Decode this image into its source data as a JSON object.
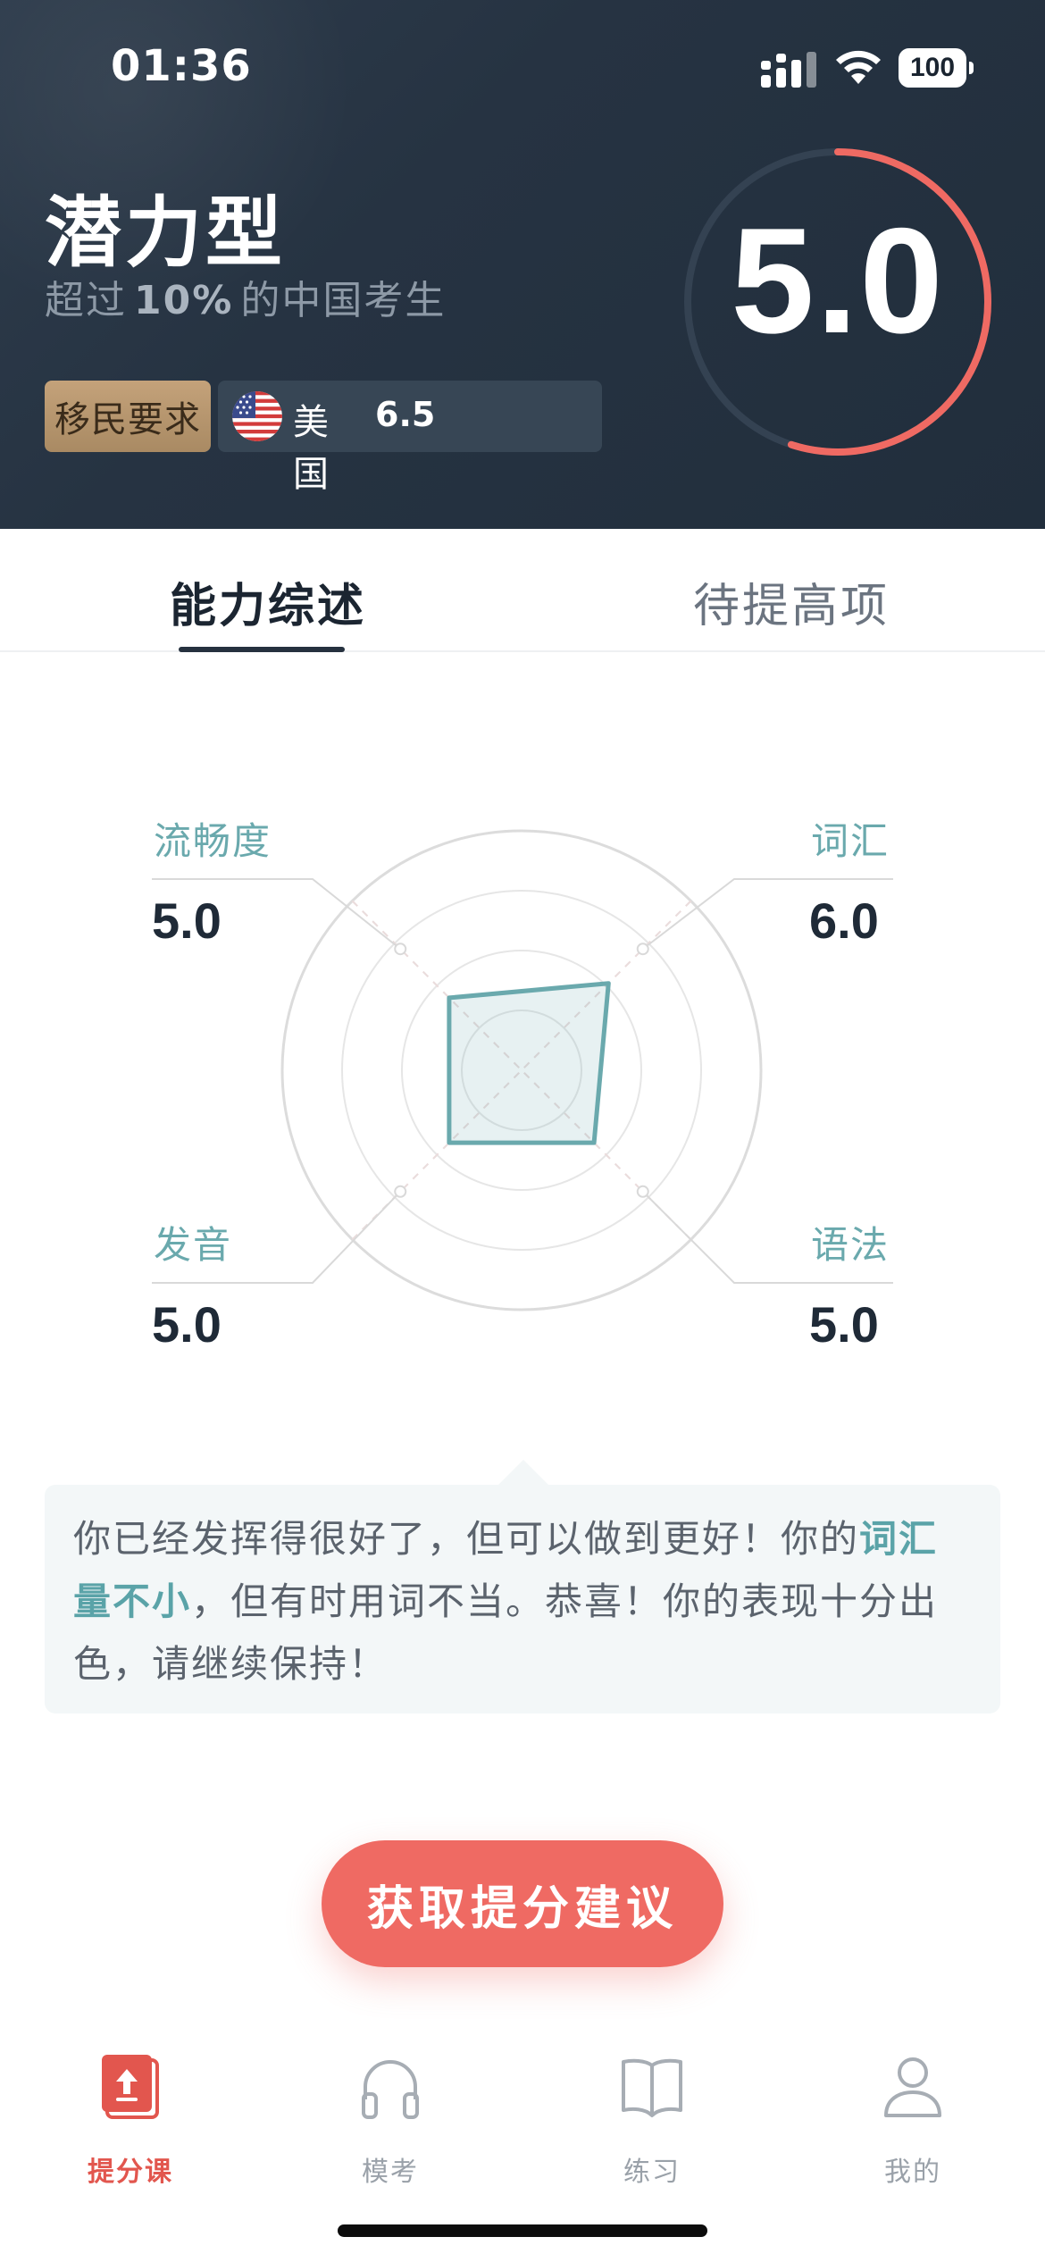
{
  "status_bar": {
    "time": "01:36",
    "battery": "100"
  },
  "header": {
    "level_title": "潜力型",
    "subtitle_prefix": "超过",
    "subtitle_percent": "10%",
    "subtitle_suffix": "的中国考生",
    "requirement_tag": "移民要求",
    "requirement_country": "美国",
    "requirement_score": "6.5",
    "overall_score": "5.0",
    "overall_score_fraction": 0.55,
    "colors": {
      "ring_accent": "#ef6a63",
      "ring_track": "#344252",
      "tag_gold": "#c4a27a"
    }
  },
  "tabs": [
    {
      "label": "能力综述",
      "active": true
    },
    {
      "label": "待提高项",
      "active": false
    }
  ],
  "skills": {
    "fluency": {
      "label": "流畅度",
      "score": "5.0"
    },
    "vocabulary": {
      "label": "词汇",
      "score": "6.0"
    },
    "pronunciation": {
      "label": "发音",
      "score": "5.0"
    },
    "grammar": {
      "label": "语法",
      "score": "5.0"
    }
  },
  "chart_data": {
    "type": "radar",
    "axes": [
      "流畅度",
      "词汇",
      "语法",
      "发音"
    ],
    "values": [
      5.0,
      6.0,
      5.0,
      5.0
    ],
    "range": [
      0,
      9
    ],
    "rings": 4,
    "color": "#6aa9ad"
  },
  "feedback": {
    "part1": "你已经发挥得很好了，但可以做到更好！你的",
    "highlight": "词汇量不小",
    "part2": "，但有时用词不当。恭喜！你的表现十分出色，请继续保持！"
  },
  "cta": {
    "label": "获取提分建议"
  },
  "bottom_nav": [
    {
      "label": "提分课",
      "icon": "upload-book-icon",
      "active": true
    },
    {
      "label": "模考",
      "icon": "headphones-icon",
      "active": false
    },
    {
      "label": "练习",
      "icon": "open-book-icon",
      "active": false
    },
    {
      "label": "我的",
      "icon": "person-icon",
      "active": false
    }
  ]
}
